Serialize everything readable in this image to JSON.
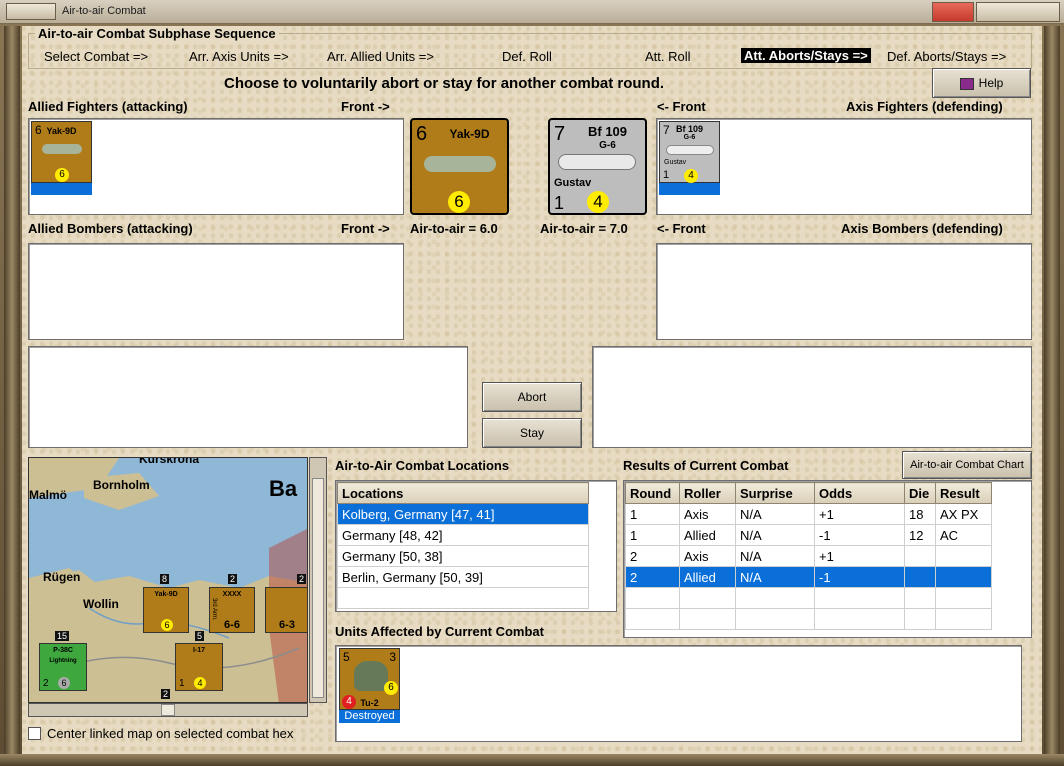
{
  "window": {
    "title": "Air-to-air Combat"
  },
  "phases": {
    "legend": "Air-to-air Combat Subphase Sequence",
    "items": [
      {
        "label": "Select Combat =>",
        "active": false
      },
      {
        "label": "Arr. Axis Units =>",
        "active": false
      },
      {
        "label": "Arr. Allied Units =>",
        "active": false
      },
      {
        "label": "Def. Roll",
        "active": false
      },
      {
        "label": "Att. Roll",
        "active": false
      },
      {
        "label": "Att. Aborts/Stays =>",
        "active": true
      },
      {
        "label": "Def. Aborts/Stays =>",
        "active": false
      }
    ]
  },
  "prompt": "Choose to voluntarily abort or stay for another combat round.",
  "help_label": "Help",
  "labels": {
    "allied_fighters": "Allied Fighters (attacking)",
    "front_right": "Front ->",
    "front_left": "<- Front",
    "axis_fighters": "Axis Fighters (defending)",
    "allied_bombers": "Allied Bombers (attacking)",
    "axis_bombers": "Axis Bombers (defending)",
    "allied_a2a": "Air-to-air = 6.0",
    "axis_a2a": "Air-to-air = 7.0"
  },
  "units": {
    "allied_small": {
      "name": "Yak-9D",
      "top": "6",
      "rating": "6"
    },
    "allied_big": {
      "name": "Yak-9D",
      "top": "6",
      "rating": "6"
    },
    "axis_big": {
      "name": "Bf 109",
      "variant": "G-6",
      "pilot": "Gustav",
      "top": "7",
      "bottom": "1",
      "rating": "4"
    },
    "axis_small": {
      "name": "Bf 109",
      "variant": "G-6",
      "pilot": "Gustav",
      "top": "7",
      "bottom": "1",
      "rating": "4"
    }
  },
  "buttons": {
    "abort": "Abort",
    "stay": "Stay",
    "chart": "Air-to-air Combat Chart"
  },
  "locations": {
    "title": "Air-to-Air Combat Locations",
    "header": "Locations",
    "rows": [
      "Kolberg, Germany [47, 41]",
      "Germany [48, 42]",
      "Germany [50, 38]",
      "Berlin, Germany [50, 39]"
    ],
    "selected": 0
  },
  "results": {
    "title": "Results of Current Combat",
    "columns": [
      "Round",
      "Roller",
      "Surprise",
      "Odds",
      "Die",
      "Result"
    ],
    "rows": [
      [
        "1",
        "Axis",
        "N/A",
        "+1",
        "18",
        "AX PX"
      ],
      [
        "1",
        "Allied",
        "N/A",
        "-1",
        "12",
        "AC"
      ],
      [
        "2",
        "Axis",
        "N/A",
        "+1",
        "",
        ""
      ],
      [
        "2",
        "Allied",
        "N/A",
        "-1",
        "",
        ""
      ]
    ],
    "selected": 3
  },
  "affected": {
    "title": "Units Affected by Current Combat",
    "unit": {
      "name": "Tu-2",
      "left": "5",
      "right": "3",
      "low": "4",
      "rating": "6",
      "status": "Destroyed"
    }
  },
  "map": {
    "labels": [
      "Kurskrona",
      "Malmö",
      "Bornholm",
      "Ba",
      "Rügen",
      "Wollin"
    ],
    "stack_counts": [
      "8",
      "2",
      "2",
      "15",
      "5",
      "2"
    ],
    "counters": [
      {
        "name": "Yak-9D",
        "rating": "6"
      },
      {
        "name": "P-38C",
        "sub": "Lightning",
        "bottom": "2",
        "rating": "6"
      },
      {
        "name": "I-17",
        "bottom": "1",
        "rating": "4"
      },
      {
        "name": "XXXX",
        "sub": "3rd Arm.",
        "value": "6-6"
      },
      {
        "value": "6-3"
      }
    ]
  },
  "center_checkbox": "Center linked map on selected combat hex"
}
